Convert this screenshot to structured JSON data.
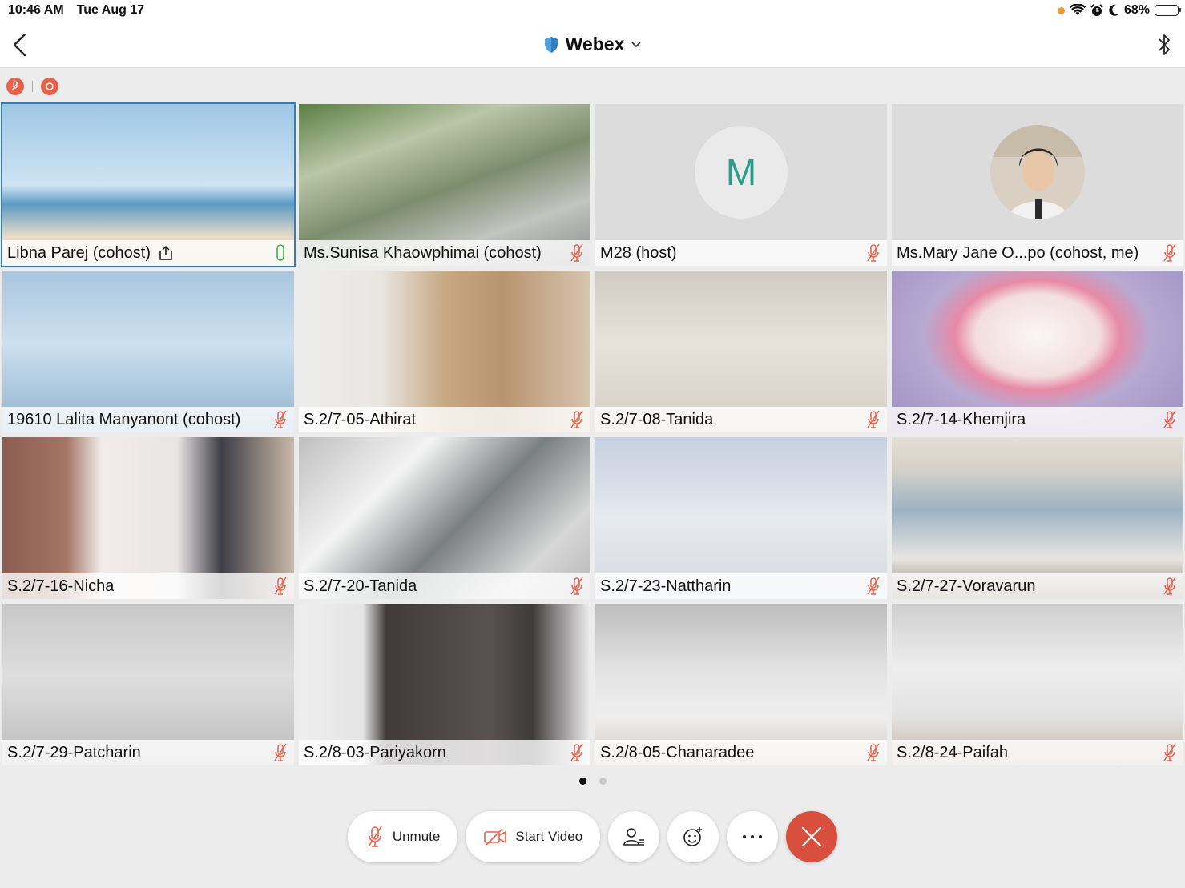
{
  "status": {
    "time": "10:46 AM",
    "date": "Tue Aug 17",
    "battery": "68%",
    "battery_level": 0.68
  },
  "header": {
    "title": "Webex"
  },
  "participants": [
    {
      "name": "Libna Parej (cohost)",
      "active": true,
      "sharing": true,
      "mic": "on",
      "bg": "beach"
    },
    {
      "name": "Ms.Sunisa Khaowphimai (cohost)",
      "mic": "muted",
      "bg": "garden"
    },
    {
      "name": "M28 (host)",
      "mic": "muted",
      "bg": "gray",
      "avatar_letter": "M"
    },
    {
      "name": "Ms.Mary Jane O...po (cohost, me)",
      "mic": "muted",
      "bg": "gray",
      "avatar_photo": true
    },
    {
      "name": "19610 Lalita Manyanont (cohost)",
      "mic": "muted",
      "bg": "blue"
    },
    {
      "name": "S.2/7-05-Athirat",
      "mic": "muted",
      "bg": "wood"
    },
    {
      "name": "S.2/7-08-Tanida",
      "mic": "muted",
      "bg": "ceilingwarm"
    },
    {
      "name": "S.2/7-14-Khemjira",
      "mic": "muted",
      "bg": "purple"
    },
    {
      "name": "S.2/7-16-Nicha",
      "mic": "muted",
      "bg": "curtain"
    },
    {
      "name": "S.2/7-20-Tanida",
      "mic": "muted",
      "bg": "room"
    },
    {
      "name": "S.2/7-23-Nattharin",
      "mic": "muted",
      "bg": "ceilingcool"
    },
    {
      "name": "S.2/7-27-Voravarun",
      "mic": "muted",
      "bg": "window"
    },
    {
      "name": "S.2/7-29-Patcharin",
      "mic": "muted",
      "bg": "ceilinggray"
    },
    {
      "name": "S.2/8-03-Pariyakorn",
      "mic": "muted",
      "bg": "cabinet"
    },
    {
      "name": "S.2/8-05-Chanaradee",
      "mic": "muted",
      "bg": "ceilingac"
    },
    {
      "name": "S.2/8-24-Paifah",
      "mic": "muted",
      "bg": "ceilinglight"
    }
  ],
  "pager": {
    "pages": 2,
    "current": 0
  },
  "controls": {
    "unmute": "Unmute",
    "start_video": "Start Video"
  },
  "colors": {
    "accent": "#3a7cad",
    "muted": "#e8604a",
    "mic_on": "#38b24a",
    "avatar_letter": "#2d9e8e",
    "leave": "#d8503d"
  },
  "icons": [
    "back-icon",
    "shield-icon",
    "chevron-down-icon",
    "bluetooth-icon",
    "mic-muted-icon",
    "share-icon",
    "video-off-icon",
    "participants-icon",
    "reaction-icon",
    "more-icon",
    "close-icon"
  ]
}
